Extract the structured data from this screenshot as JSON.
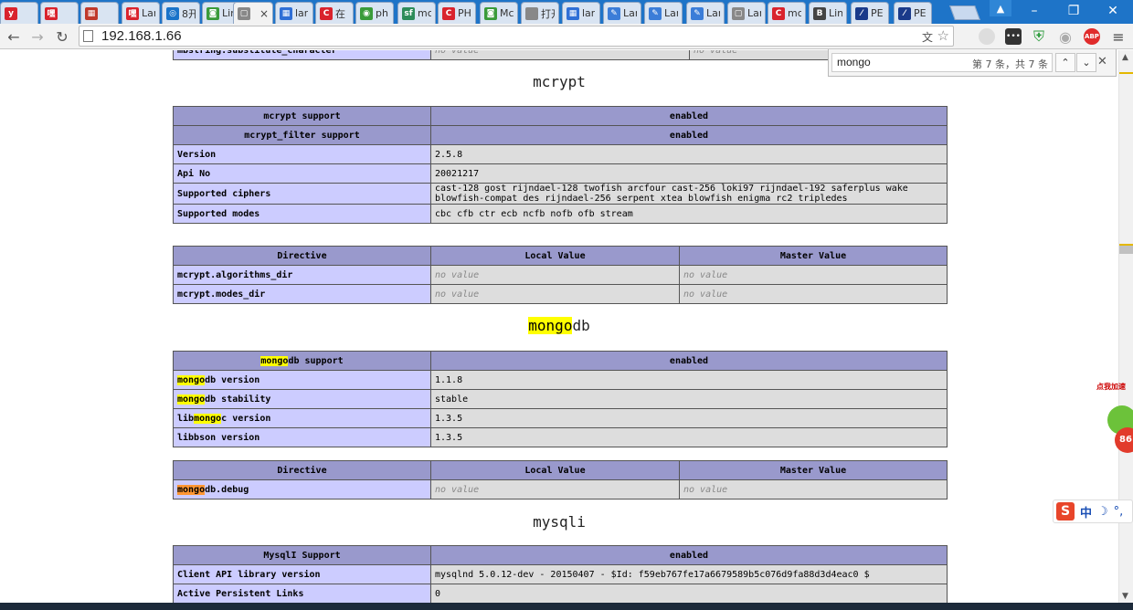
{
  "browser": {
    "tabs": [
      {
        "title": "",
        "fav": "y",
        "color": "#d9232d"
      },
      {
        "title": "",
        "fav": "嘿",
        "color": "#d9232d"
      },
      {
        "title": "",
        "fav": "▦",
        "color": "#c0392b"
      },
      {
        "title": "Lar",
        "fav": "嘿",
        "color": "#d9232d"
      },
      {
        "title": "8开",
        "fav": "◎",
        "color": "#1a73c9"
      },
      {
        "title": "Lin",
        "fav": "◙",
        "color": "#3a9b3a"
      },
      {
        "title": "×",
        "fav": "▢",
        "color": "#888888",
        "active": true
      },
      {
        "title": "lar",
        "fav": "▦",
        "color": "#2f6fd6"
      },
      {
        "title": "在",
        "fav": "C",
        "color": "#d9232d"
      },
      {
        "title": "ph",
        "fav": "◉",
        "color": "#3a9b3a"
      },
      {
        "title": "mc",
        "fav": "sf",
        "color": "#2d8c5a"
      },
      {
        "title": "PH",
        "fav": "C",
        "color": "#d9232d"
      },
      {
        "title": "Mc",
        "fav": "◙",
        "color": "#3a9b3a"
      },
      {
        "title": "打开",
        "fav": "",
        "color": "#888888"
      },
      {
        "title": "lar",
        "fav": "▦",
        "color": "#2f6fd6"
      },
      {
        "title": "Lar",
        "fav": "✎",
        "color": "#3b7dd8"
      },
      {
        "title": "Lar",
        "fav": "✎",
        "color": "#3b7dd8"
      },
      {
        "title": "Lar",
        "fav": "✎",
        "color": "#3b7dd8"
      },
      {
        "title": "Lar",
        "fav": "▢",
        "color": "#888888"
      },
      {
        "title": "mc",
        "fav": "C",
        "color": "#d9232d"
      },
      {
        "title": "Lin",
        "fav": "B",
        "color": "#444444"
      },
      {
        "title": "PE",
        "fav": "⁄",
        "color": "#1a3a8a"
      },
      {
        "title": "PE",
        "fav": "⁄",
        "color": "#1a3a8a"
      }
    ],
    "url": "192.168.1.66"
  },
  "find": {
    "query": "mongo",
    "count": "第 7 条，共 7 条"
  },
  "page": {
    "top_row": {
      "key": "mbstring.substitute_character",
      "local": "no value",
      "master": "no value"
    },
    "mcrypt": {
      "title": "mcrypt",
      "info": [
        {
          "key": "mcrypt support",
          "value": "enabled",
          "header": true
        },
        {
          "key": "mcrypt_filter support",
          "value": "enabled",
          "header": true
        },
        {
          "key": "Version",
          "value": "2.5.8"
        },
        {
          "key": "Api No",
          "value": "20021217"
        },
        {
          "key": "Supported ciphers",
          "value": "cast-128 gost rijndael-128 twofish arcfour cast-256 loki97 rijndael-192 saferplus wake blowfish-compat des rijndael-256 serpent xtea blowfish enigma rc2 tripledes"
        },
        {
          "key": "Supported modes",
          "value": "cbc cfb ctr ecb ncfb nofb ofb stream"
        }
      ],
      "directives": [
        {
          "key": "mcrypt.algorithms_dir",
          "local": "no value",
          "master": "no value"
        },
        {
          "key": "mcrypt.modes_dir",
          "local": "no value",
          "master": "no value"
        }
      ]
    },
    "mongodb": {
      "title_hl": "mongo",
      "title_rest": "db",
      "info": [
        {
          "pre": "",
          "hl": "mongo",
          "post": "db support",
          "value": "enabled",
          "header": true
        },
        {
          "pre": "",
          "hl": "mongo",
          "post": "db version",
          "value": "1.1.8"
        },
        {
          "pre": "",
          "hl": "mongo",
          "post": "db stability",
          "value": "stable"
        },
        {
          "pre": "lib",
          "hl": "mongo",
          "post": "c version",
          "value": "1.3.5"
        },
        {
          "pre": "libbson version",
          "hl": "",
          "post": "",
          "value": "1.3.5"
        }
      ],
      "directives": [
        {
          "hl": "mongo",
          "post": "db.debug",
          "local": "no value",
          "master": "no value"
        }
      ]
    },
    "mysqli": {
      "title": "mysqli",
      "info": [
        {
          "key": "MysqlI Support",
          "value": "enabled",
          "header": true
        },
        {
          "key": "Client API library version",
          "value": "mysqlnd 5.0.12-dev - 20150407 - $Id: f59eb767fe17a6679589b5c076d9fa88d3d4eac0 $"
        },
        {
          "key": "Active Persistent Links",
          "value": "0"
        }
      ]
    },
    "headers": {
      "directive": "Directive",
      "local": "Local Value",
      "master": "Master Value"
    }
  },
  "widgets": {
    "accel_label": "点我加速",
    "accel_count": "86",
    "ime_label": "中"
  }
}
